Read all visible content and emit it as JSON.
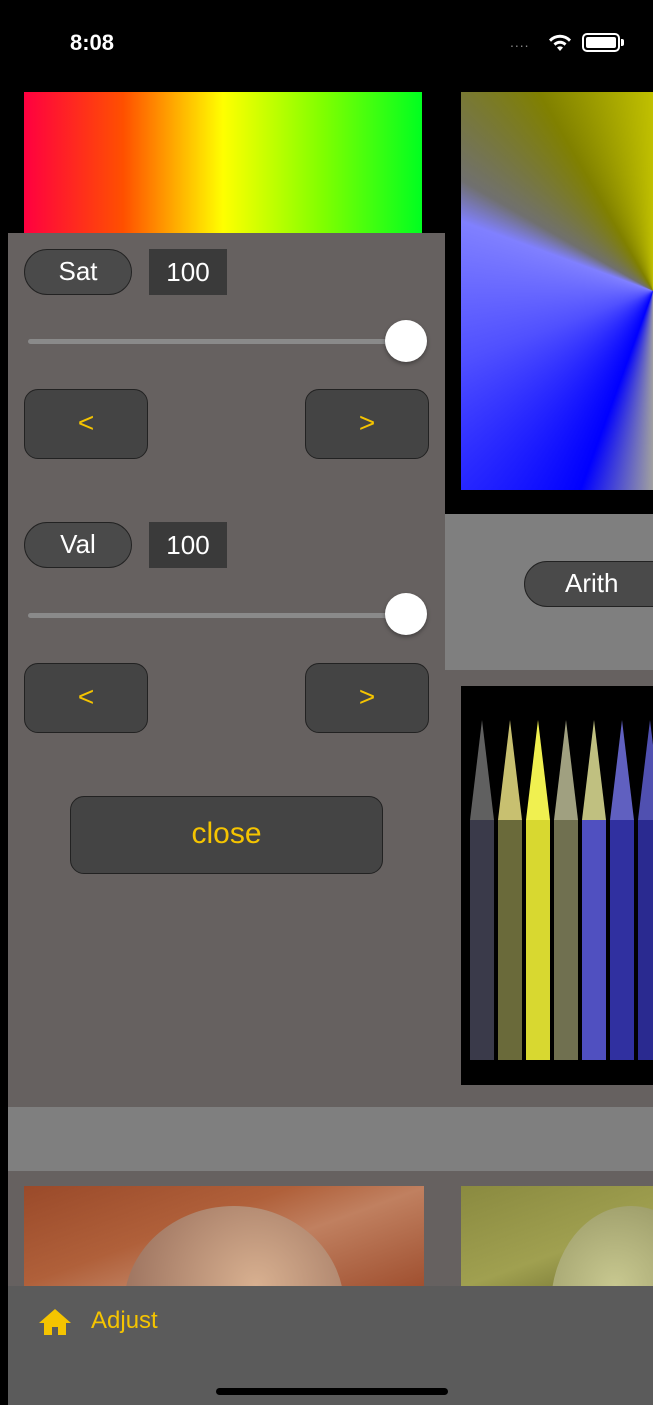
{
  "status_bar": {
    "time": "8:08",
    "signal_dots": "....",
    "wifi_icon": "wifi-icon",
    "battery_icon": "battery-icon"
  },
  "arith_button": {
    "label": "Arith"
  },
  "adjust_panel": {
    "sat": {
      "label": "Sat",
      "value": "100",
      "slider_level": 1.0,
      "prev_label": "<",
      "next_label": ">"
    },
    "val": {
      "label": "Val",
      "value": "100",
      "slider_level": 1.0,
      "prev_label": "<",
      "next_label": ">"
    },
    "close_label": "close"
  },
  "toolbar": {
    "home_icon": "home-icon",
    "adjust_label": "Adjust"
  },
  "colors": {
    "accent": "#f5c400",
    "panel": "#666160",
    "button": "#444444"
  }
}
